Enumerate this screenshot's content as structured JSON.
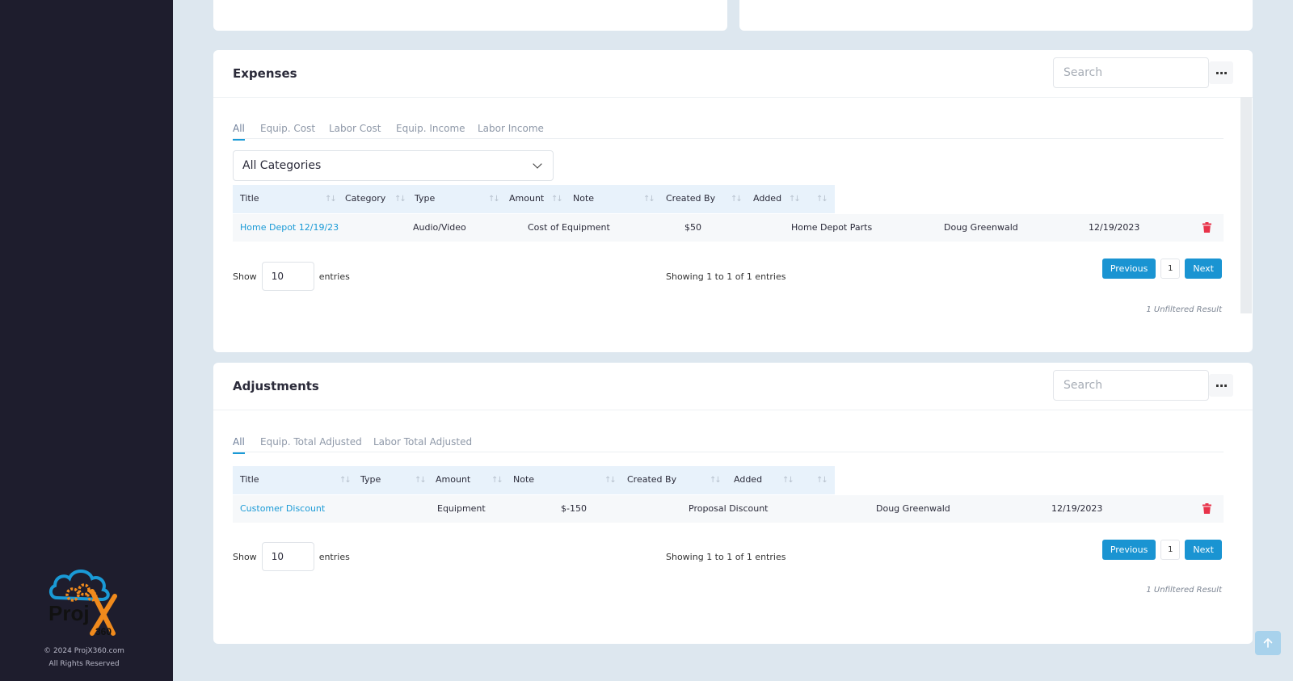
{
  "brand": {
    "name": "ProjX360",
    "copyright": "© 2024 ProjX360.com",
    "rights": "All Rights Reserved"
  },
  "expenses": {
    "title": "Expenses",
    "search_placeholder": "Search",
    "tabs": [
      "All",
      "Equip. Cost",
      "Labor Cost",
      "Equip. Income",
      "Labor Income"
    ],
    "category_select": "All Categories",
    "columns": [
      "Title",
      "Category",
      "Type",
      "Amount",
      "Note",
      "Created By",
      "Added"
    ],
    "rows": [
      {
        "title": "Home Depot 12/19/23",
        "category": "Audio/Video",
        "type": "Cost of Equipment",
        "amount": "$50",
        "note": "Home Depot Parts",
        "created_by": "Doug Greenwald",
        "added": "12/19/2023"
      }
    ],
    "show_label": "Show",
    "page_size": "10",
    "entries_label": "entries",
    "showing_text": "Showing 1 to 1 of 1 entries",
    "previous": "Previous",
    "page": "1",
    "next": "Next",
    "unfiltered": "1 Unfiltered Result"
  },
  "adjustments": {
    "title": "Adjustments",
    "search_placeholder": "Search",
    "tabs": [
      "All",
      "Equip. Total Adjusted",
      "Labor Total Adjusted"
    ],
    "columns": [
      "Title",
      "Type",
      "Amount",
      "Note",
      "Created By",
      "Added"
    ],
    "rows": [
      {
        "title": "Customer Discount",
        "type": "Equipment",
        "amount": "$-150",
        "note": "Proposal Discount",
        "created_by": "Doug Greenwald",
        "added": "12/19/2023"
      }
    ],
    "show_label": "Show",
    "page_size": "10",
    "entries_label": "entries",
    "showing_text": "Showing 1 to 1 of 1 entries",
    "previous": "Previous",
    "page": "1",
    "next": "Next",
    "unfiltered": "1 Unfiltered Result"
  },
  "colors": {
    "sidebar": "#1e1d2d",
    "accent": "#1a94d2",
    "delete": "#e8334a",
    "page_bg": "#dde7ef"
  },
  "icons": {
    "more": "more-horizontal-icon",
    "delete": "trash-icon",
    "sort": "sort-arrows-icon",
    "dropdown": "chevron-down-icon",
    "back_to_top": "arrow-up-icon"
  }
}
